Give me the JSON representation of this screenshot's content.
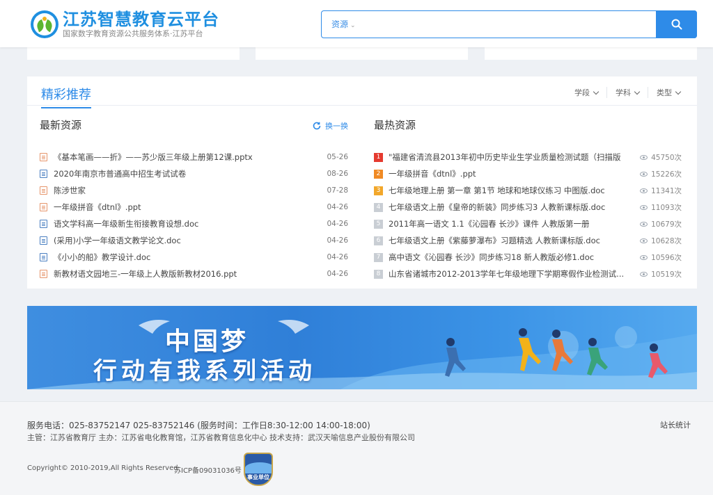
{
  "header": {
    "logo_title": "江苏智慧教育云平台",
    "logo_subtitle": "国家数字教育资源公共服务体系·江苏平台",
    "logo_icon": "education-cloud-logo",
    "search": {
      "type_label": "资源",
      "placeholder": "",
      "button_icon": "search-icon"
    }
  },
  "recommend": {
    "title": "精彩推荐",
    "filters": [
      "学段",
      "学科",
      "类型"
    ],
    "latest": {
      "title": "最新资源",
      "refresh_label": "换一换",
      "items": [
        {
          "name": "《基本笔画——折》——苏少版三年级上册第12课.pptx",
          "date": "05-26",
          "type": "ppt"
        },
        {
          "name": "2020年南京市普通高中招生考试试卷",
          "date": "08-26",
          "type": "doc"
        },
        {
          "name": "陈涉世家",
          "date": "07-28",
          "type": "ppt"
        },
        {
          "name": "一年级拼音《dtnl》.ppt",
          "date": "04-26",
          "type": "ppt"
        },
        {
          "name": "语文学科高一年级新生衔接教育设想.doc",
          "date": "04-26",
          "type": "doc"
        },
        {
          "name": "(采用)小学一年级语文教学论文.doc",
          "date": "04-26",
          "type": "doc"
        },
        {
          "name": "《小小的船》教学设计.doc",
          "date": "04-26",
          "type": "doc"
        },
        {
          "name": "新教材语文园地三-一年级上人教版新教材2016.ppt",
          "date": "04-26",
          "type": "ppt"
        }
      ]
    },
    "hottest": {
      "title": "最热资源",
      "items": [
        {
          "rank": "1",
          "name": "\"福建省清流县2013年初中历史毕业生学业质量检测试题（扫描版",
          "views": "45750次",
          "color": "#e53a2f"
        },
        {
          "rank": "2",
          "name": "一年级拼音《dtnl》.ppt",
          "views": "15226次",
          "color": "#f08a24"
        },
        {
          "rank": "3",
          "name": "七年级地理上册 第一章 第1节 地球和地球仪练习 中图版.doc",
          "views": "11341次",
          "color": "#f2a72a"
        },
        {
          "rank": "4",
          "name": "七年级语文上册《皇帝的新装》同步练习3 人教新课标版.doc",
          "views": "11093次",
          "color": "#c9ced4"
        },
        {
          "rank": "5",
          "name": "2011年高一语文 1.1《沁园春 长沙》课件 人教版第一册",
          "views": "10679次",
          "color": "#c9ced4"
        },
        {
          "rank": "6",
          "name": "七年级语文上册《紫藤萝瀑布》习题精选 人教新课标版.doc",
          "views": "10628次",
          "color": "#c9ced4"
        },
        {
          "rank": "7",
          "name": "高中语文《沁园春 长沙》同步练习18 新人教版必修1.doc",
          "views": "10596次",
          "color": "#c9ced4"
        },
        {
          "rank": "8",
          "name": "山东省诸城市2012-2013学年七年级地理下学期寒假作业检测试...",
          "views": "10519次",
          "color": "#c9ced4"
        }
      ]
    }
  },
  "banner": {
    "title": "中国梦",
    "subtitle": "行动有我系列活动"
  },
  "footer": {
    "service_line": "服务电话：025-83752147    025-83752146    (服务时间：工作日8:30-12:00 14:00-18:00)",
    "sponsor_line": "主管：江苏省教育厅   主办：江苏省电化教育馆，江苏省教育信息化中心   技术支持：武汉天喻信息产业股份有限公司",
    "stats_link": "站长统计",
    "copyright": "Copyright© 2010-2019,All Rights Reserved",
    "icp": "苏ICP备09031036号",
    "badge_label": "事业单位"
  }
}
